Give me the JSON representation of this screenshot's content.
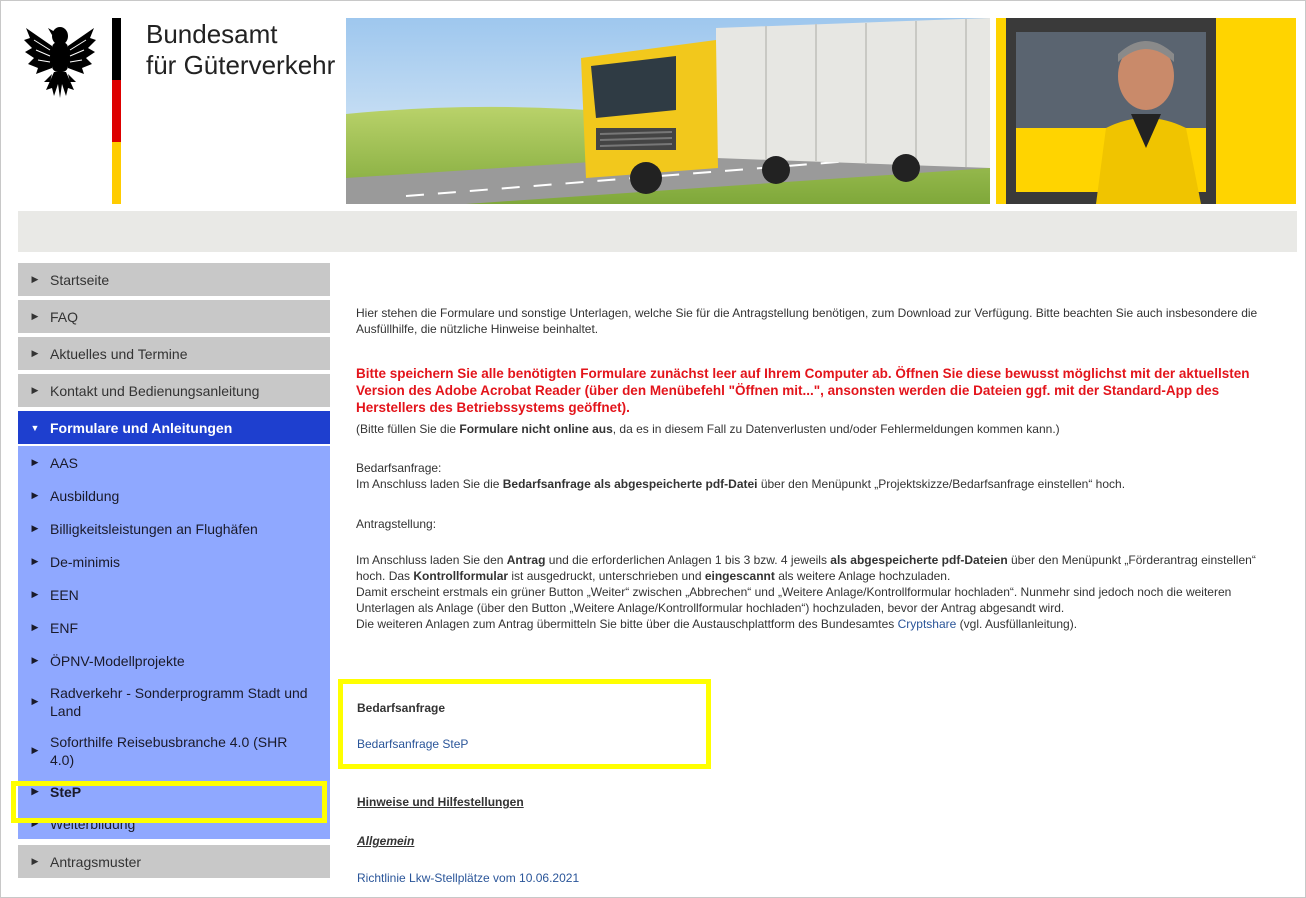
{
  "header": {
    "title_line1": "Bundesamt",
    "title_line2": "für Güterverkehr"
  },
  "sidebar": {
    "top_items": [
      {
        "label": "Startseite"
      },
      {
        "label": "FAQ"
      },
      {
        "label": "Aktuelles und Termine"
      },
      {
        "label": "Kontakt und Bedienungsanleitung"
      }
    ],
    "active_item": {
      "label": "Formulare und Anleitungen"
    },
    "sub_items": [
      {
        "label": "AAS"
      },
      {
        "label": "Ausbildung"
      },
      {
        "label": "Billigkeitsleistungen an Flughäfen"
      },
      {
        "label": "De-minimis"
      },
      {
        "label": "EEN"
      },
      {
        "label": "ENF"
      },
      {
        "label": "ÖPNV-Modellprojekte"
      },
      {
        "label": "Radverkehr - Sonderprogramm Stadt und Land"
      },
      {
        "label": "Soforthilfe Reisebusbranche 4.0 (SHR 4.0)"
      },
      {
        "label": "SteP"
      },
      {
        "label": "Weiterbildung"
      }
    ],
    "bottom_items": [
      {
        "label": "Antragsmuster"
      }
    ]
  },
  "content": {
    "intro": "Hier stehen die Formulare und sonstige Unterlagen, welche Sie für die Antragstellung benötigen, zum Download zur Verfügung. Bitte beachten Sie auch insbesondere die Ausfüllhilfe, die nützliche Hinweise beinhaltet.",
    "warning": "Bitte speichern Sie alle benötigten Formulare zunächst leer auf Ihrem Computer ab. Öffnen Sie diese bewusst möglichst mit der aktuellsten Version des Adobe Acrobat Reader (über den Menübefehl \"Öffnen mit...\", ansonsten werden die Dateien ggf. mit der Standard-App des Herstellers des Betriebssystems geöffnet).",
    "note_before": "(Bitte füllen Sie die ",
    "note_bold": "Formulare nicht online aus",
    "note_after": ", da es in diesem Fall zu Datenverlusten und/oder Fehlermeldungen kommen kann.)",
    "bedarf_heading": "Bedarfsanfrage:",
    "bedarf_before": "Im Anschluss laden Sie die ",
    "bedarf_bold": "Bedarfsanfrage als abgespeicherte pdf-Datei",
    "bedarf_after": " über den Menüpunkt „Projektskizze/Bedarfsanfrage einstellen“ hoch.",
    "antrag_heading": "Antragstellung:",
    "antrag_p1_a": "Im Anschluss laden Sie den ",
    "antrag_p1_b": "Antrag",
    "antrag_p1_c": " und die erforderlichen Anlagen 1 bis 3 bzw. 4 jeweils ",
    "antrag_p1_d": "als abgespeicherte pdf-Dateien",
    "antrag_p1_e": " über den Menüpunkt „Förderantrag einstellen“ hoch. Das ",
    "antrag_p1_f": "Kontrollformular",
    "antrag_p1_g": " ist ausgedruckt, unterschrieben und ",
    "antrag_p1_h": "eingescannt",
    "antrag_p1_i": " als weitere Anlage hochzuladen.",
    "antrag_p2": "Damit erscheint erstmals ein grüner Button „Weiter“ zwischen „Abbrechen“ und „Weitere Anlage/Kontrollformular hochladen“. Nunmehr sind jedoch noch die weiteren Unterlagen als Anlage (über den Button „Weitere Anlage/Kontrollformular hochladen“) hochzuladen, bevor der Antrag abgesandt wird.",
    "antrag_p3_before": "Die weiteren Anlagen zum Antrag übermitteln Sie bitte über die Austauschplattform des Bundesamtes ",
    "antrag_p3_link": "Cryptshare",
    "antrag_p3_after": " (vgl. Ausfüllanleitung).",
    "box_title": "Bedarfsanfrage",
    "box_link": "Bedarfsanfrage SteP",
    "hinweise": "Hinweise und Hilfestellungen",
    "allgemein": "Allgemein",
    "richtlinie": "Richtlinie Lkw-Stellplätze vom 10.06.2021"
  },
  "colors": {
    "active_nav": "#1e3fcf",
    "sub_nav": "#8fa8ff",
    "top_nav": "#c8c8c8",
    "warning_text": "#e3141b",
    "link": "#2a5599",
    "highlight": "#ffff00"
  }
}
